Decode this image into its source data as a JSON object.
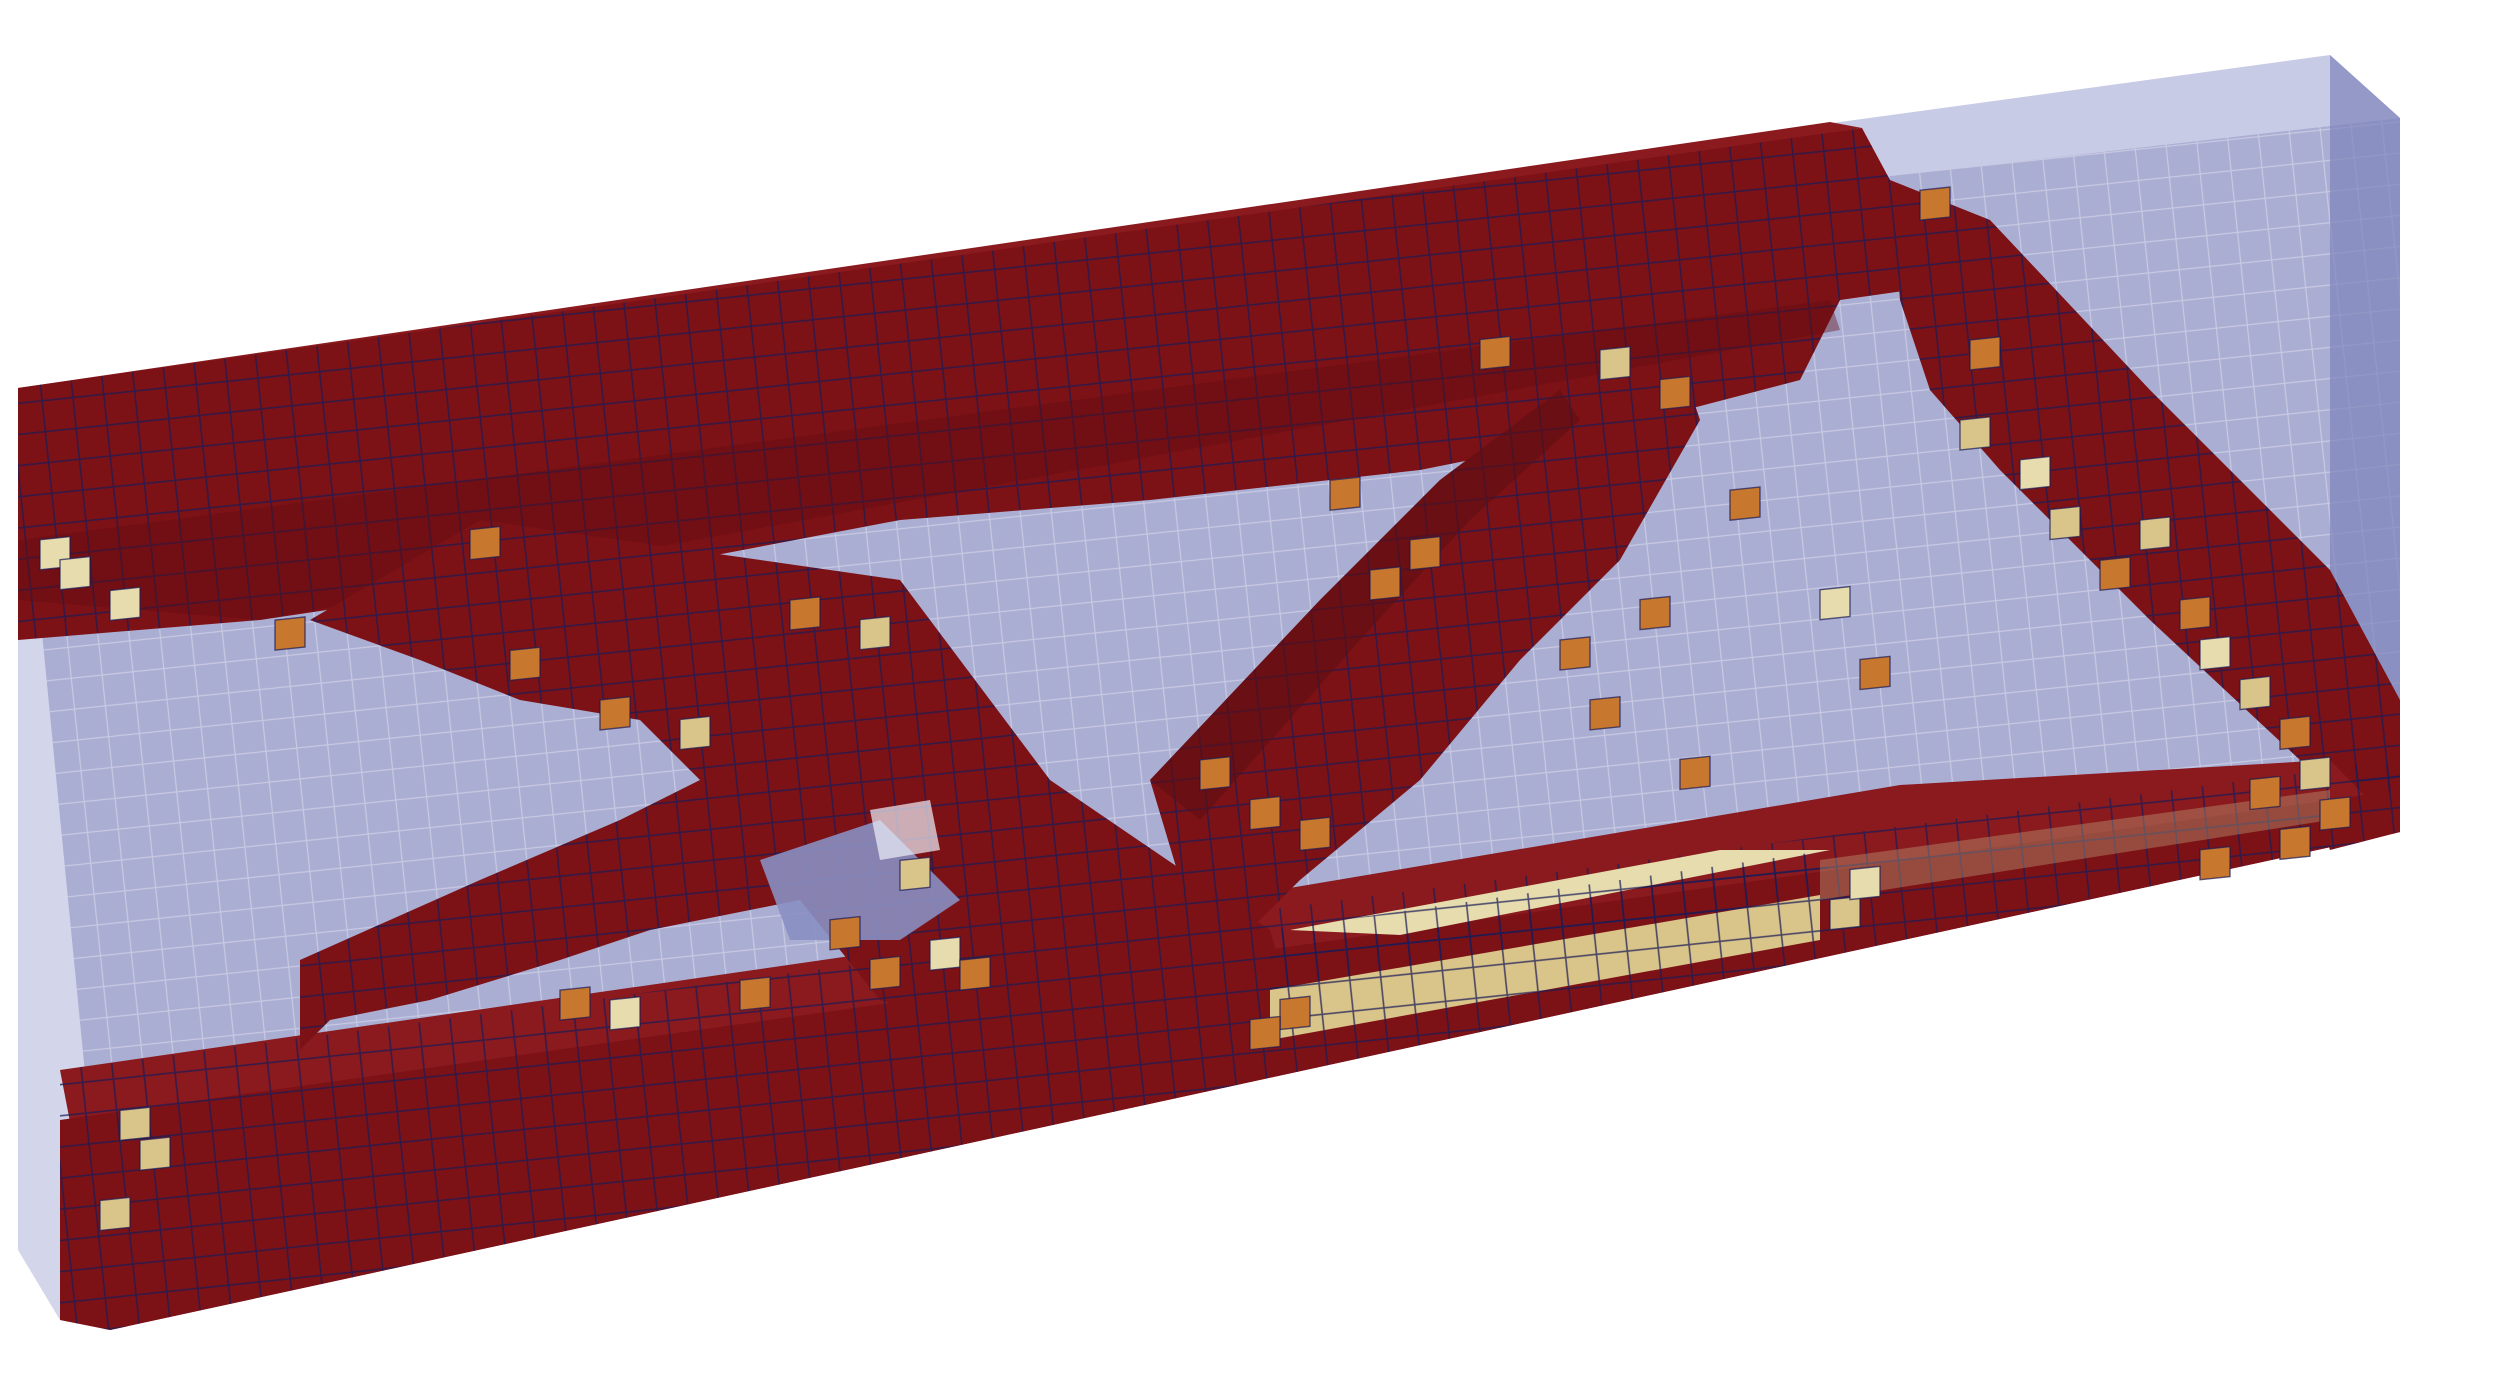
{
  "scene": {
    "background": "#ffffff",
    "palette": {
      "solid": "#7d1216",
      "solid_dark": "#5e0d12",
      "solid_top": "#8a1a1e",
      "orange": "#c8782e",
      "tan": "#d9c48a",
      "pale": "#e6dcae",
      "void": "#8a8fc2",
      "void_edge": "#6e74b0",
      "grid": "#1a1a55"
    }
  }
}
